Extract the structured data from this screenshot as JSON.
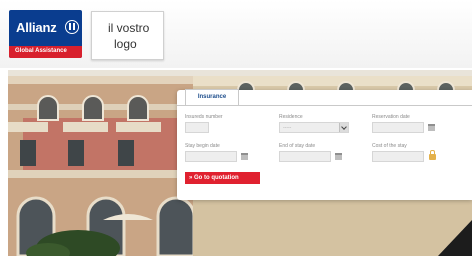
{
  "header": {
    "brand_logo": {
      "name": "Allianz",
      "tagline": "Global Assistance"
    },
    "partner_logo": {
      "line1": "il vostro",
      "line2": "logo"
    }
  },
  "quote_form": {
    "tab_label": "Insurance",
    "fields": {
      "insureds_number": {
        "label": "Insureds number",
        "value": ""
      },
      "residence": {
        "label": "Residence",
        "value": "-----"
      },
      "reservation_date": {
        "label": "Reservation date",
        "value": ""
      },
      "stay_begin_date": {
        "label": "Stay begin date",
        "value": ""
      },
      "end_of_stay_date": {
        "label": "End of stay date",
        "value": ""
      },
      "cost_of_stay": {
        "label": "Cost of the stay",
        "value": ""
      }
    },
    "submit_label": "» Go to quotation"
  },
  "colors": {
    "allianz_blue": "#0a3d8f",
    "allianz_red": "#d8202d",
    "button_red": "#e0212f",
    "tab_text": "#1e4e8c"
  },
  "icons": [
    "allianz-emblem-icon",
    "calendar-icon",
    "lock-icon",
    "chevron-down-icon"
  ]
}
